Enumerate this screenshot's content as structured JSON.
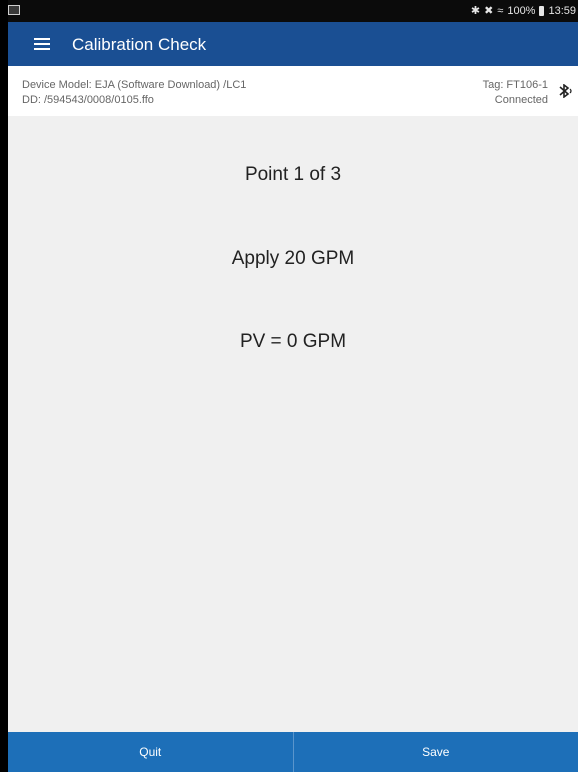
{
  "status_bar": {
    "battery": "100%",
    "time": "13:59"
  },
  "app_bar": {
    "title": "Calibration Check"
  },
  "device_info": {
    "model_line": "Device Model:  EJA (Software Download) /LC1",
    "dd_line": "DD:  /594543/0008/0105.ffo",
    "tag_line": "Tag:  FT106-1",
    "connection_status": "Connected"
  },
  "calibration": {
    "point_text": "Point 1 of 3",
    "instruction_text": "Apply 20 GPM",
    "pv_text": "PV = 0 GPM"
  },
  "actions": {
    "quit_label": "Quit",
    "save_label": "Save"
  },
  "icons": {
    "menu": "hamburger-menu-icon",
    "bluetooth": "bluetooth-icon",
    "wifi": "wifi-icon",
    "mute": "mute-icon",
    "battery": "battery-icon",
    "gallery": "gallery-notification-icon"
  },
  "colors": {
    "app_bar": "#1a4f93",
    "bottom_bar": "#1d6fb8",
    "background": "#f0f0f0"
  }
}
